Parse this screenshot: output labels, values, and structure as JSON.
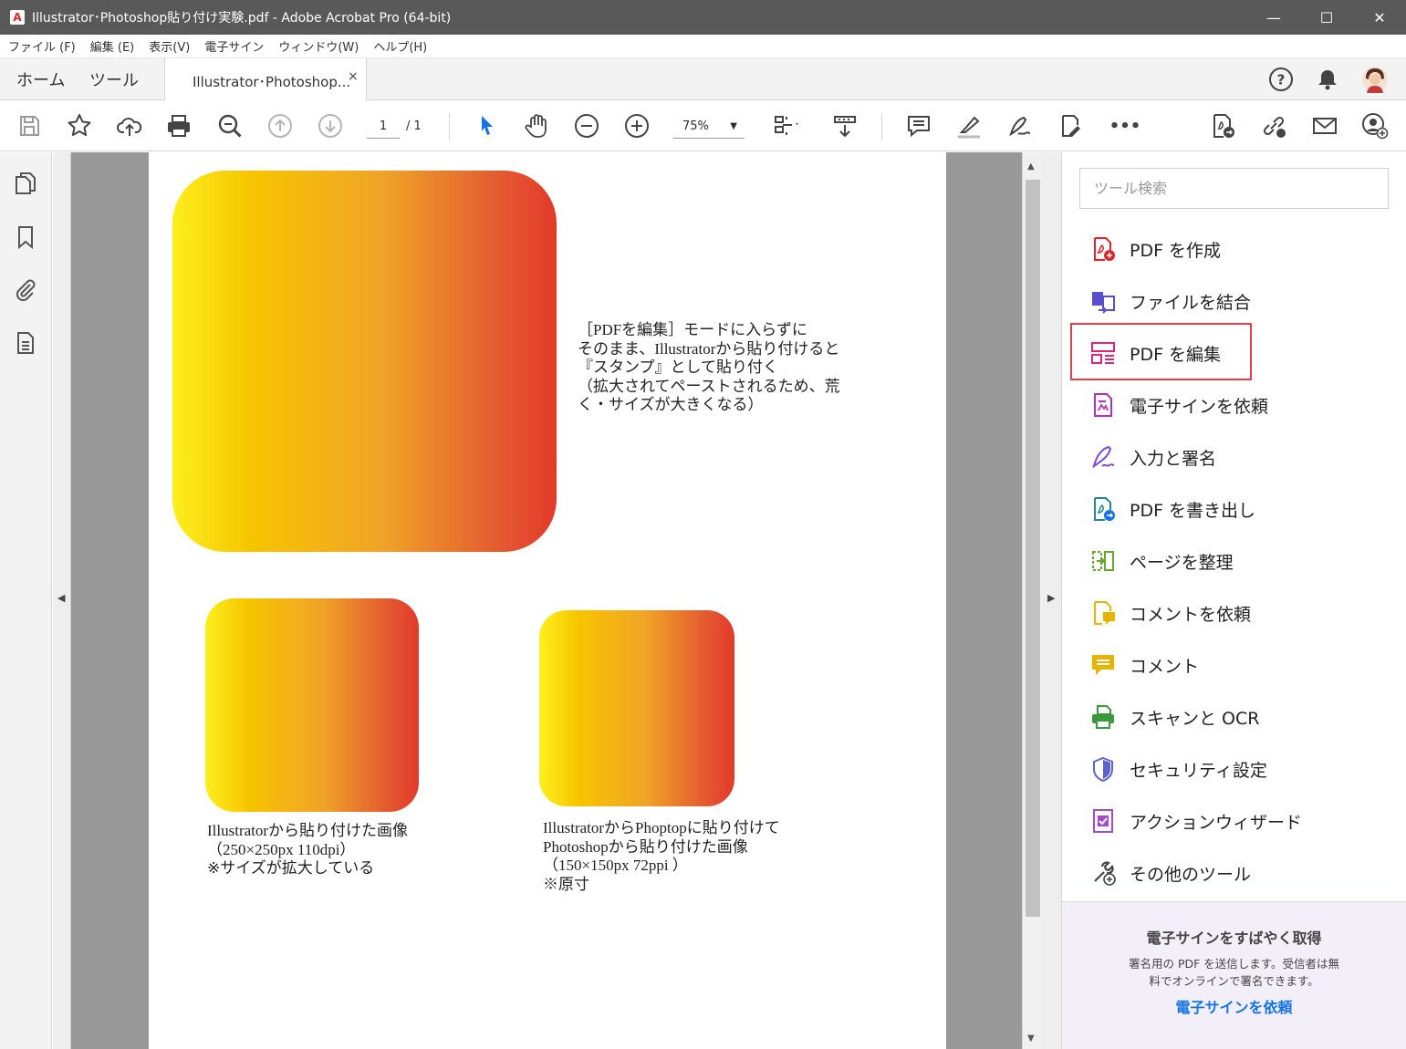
{
  "window": {
    "title": "Illustrator･Photoshop貼り付け実験.pdf - Adobe Acrobat Pro (64-bit)",
    "minimize": "—",
    "maximize": "☐",
    "close": "✕"
  },
  "menu": [
    "ファイル (F)",
    "編集 (E)",
    "表示(V)",
    "電子サイン",
    "ウィンドウ(W)",
    "ヘルプ(H)"
  ],
  "tabs": {
    "home": "ホーム",
    "tools": "ツール",
    "document": "Illustrator･Photoshop...",
    "close": "×"
  },
  "toolbar": {
    "page_current": "1",
    "page_total": "/ 1",
    "zoom": "75%",
    "more": "•••"
  },
  "document": {
    "note_text": "［PDFを編集］モードに入らずに\nそのまま、Illustratorから貼り付けると\n『スタンプ』として貼り付く\n（拡大されてペーストされるため、荒\nく・サイズが大きくなる）",
    "caption_left": "Illustratorから貼り付けた画像\n（250×250px 110dpi）\n※サイズが拡大している",
    "caption_right": "IllustratorからPhoptopに貼り付けて\nPhotoshopから貼り付けた画像\n（150×150px 72ppi ）\n※原寸"
  },
  "right_panel": {
    "search_placeholder": "ツール検索",
    "tools": [
      {
        "label": "PDF を作成",
        "icon": "create-pdf-icon",
        "color": "#e0242a"
      },
      {
        "label": "ファイルを結合",
        "icon": "combine-files-icon",
        "color": "#5b4fd1"
      },
      {
        "label": "PDF を編集",
        "icon": "edit-pdf-icon",
        "color": "#e0247a"
      },
      {
        "label": "電子サインを依頼",
        "icon": "request-signature-icon",
        "color": "#b42fc0"
      },
      {
        "label": "入力と署名",
        "icon": "fill-sign-icon",
        "color": "#7a4bd6"
      },
      {
        "label": "PDF を書き出し",
        "icon": "export-pdf-icon",
        "color": "#1f8a8a"
      },
      {
        "label": "ページを整理",
        "icon": "organize-pages-icon",
        "color": "#6aa62b"
      },
      {
        "label": "コメントを依頼",
        "icon": "request-comments-icon",
        "color": "#e8b400"
      },
      {
        "label": "コメント",
        "icon": "comment-icon",
        "color": "#e8b400"
      },
      {
        "label": "スキャンと OCR",
        "icon": "scan-ocr-icon",
        "color": "#3a9a3a"
      },
      {
        "label": "セキュリティ設定",
        "icon": "shield-icon",
        "color": "#5a64c8"
      },
      {
        "label": "アクションウィザード",
        "icon": "action-wizard-icon",
        "color": "#a44bc8"
      },
      {
        "label": "その他のツール",
        "icon": "more-tools-icon",
        "color": "#444444"
      }
    ],
    "promo": {
      "title": "電子サインをすばやく取得",
      "desc": "署名用の PDF を送信します。受信者は無料でオンラインで署名できます。",
      "link": "電子サインを依頼"
    }
  }
}
